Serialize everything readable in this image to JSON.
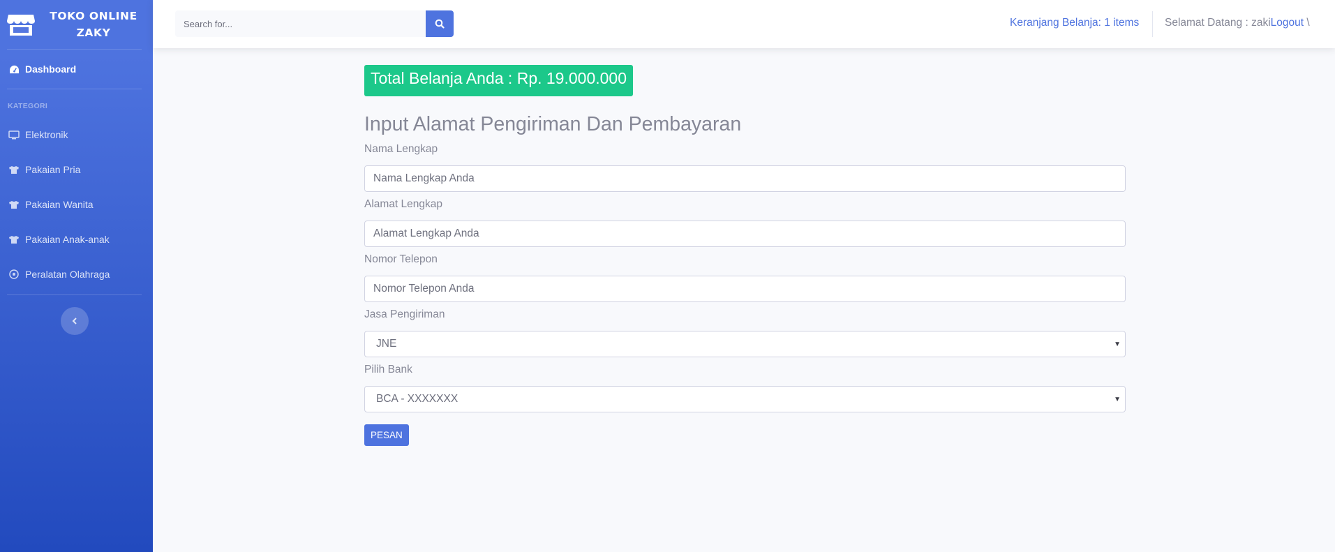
{
  "brand": {
    "line1": "TOKO ONLINE",
    "line2": "ZAKY",
    "icon": "store-icon"
  },
  "sidebar": {
    "dashboard": {
      "label": "Dashboard",
      "icon": "tachometer-icon"
    },
    "heading": "KATEGORI",
    "items": [
      {
        "label": "Elektronik",
        "icon": "desktop-icon"
      },
      {
        "label": "Pakaian Pria",
        "icon": "tshirt-icon"
      },
      {
        "label": "Pakaian Wanita",
        "icon": "tshirt-icon"
      },
      {
        "label": "Pakaian Anak-anak",
        "icon": "tshirt-icon"
      },
      {
        "label": "Peralatan Olahraga",
        "icon": "futbol-icon"
      }
    ],
    "toggle_icon": "chevron-left-icon"
  },
  "topbar": {
    "search_placeholder": "Search for...",
    "cart": "Keranjang Belanja: 1 items",
    "welcome": "Selamat Datang : zaki",
    "logout": "Logout",
    "trailing": " \\"
  },
  "main": {
    "total": "Total Belanja Anda : Rp. 19.000.000",
    "title": "Input Alamat Pengiriman Dan Pembayaran",
    "fields": {
      "nama": {
        "label": "Nama Lengkap",
        "placeholder": "Nama Lengkap Anda"
      },
      "alamat": {
        "label": "Alamat Lengkap",
        "placeholder": "Alamat Lengkap Anda"
      },
      "telepon": {
        "label": "Nomor Telepon",
        "placeholder": "Nomor Telepon Anda"
      },
      "jasa": {
        "label": "Jasa Pengiriman",
        "value": "JNE"
      },
      "bank": {
        "label": "Pilih Bank",
        "value": "BCA - XXXXXXX"
      }
    },
    "submit": "PESAN"
  },
  "colors": {
    "primary": "#4e73df",
    "success": "#1cc88a",
    "text": "#858796"
  }
}
